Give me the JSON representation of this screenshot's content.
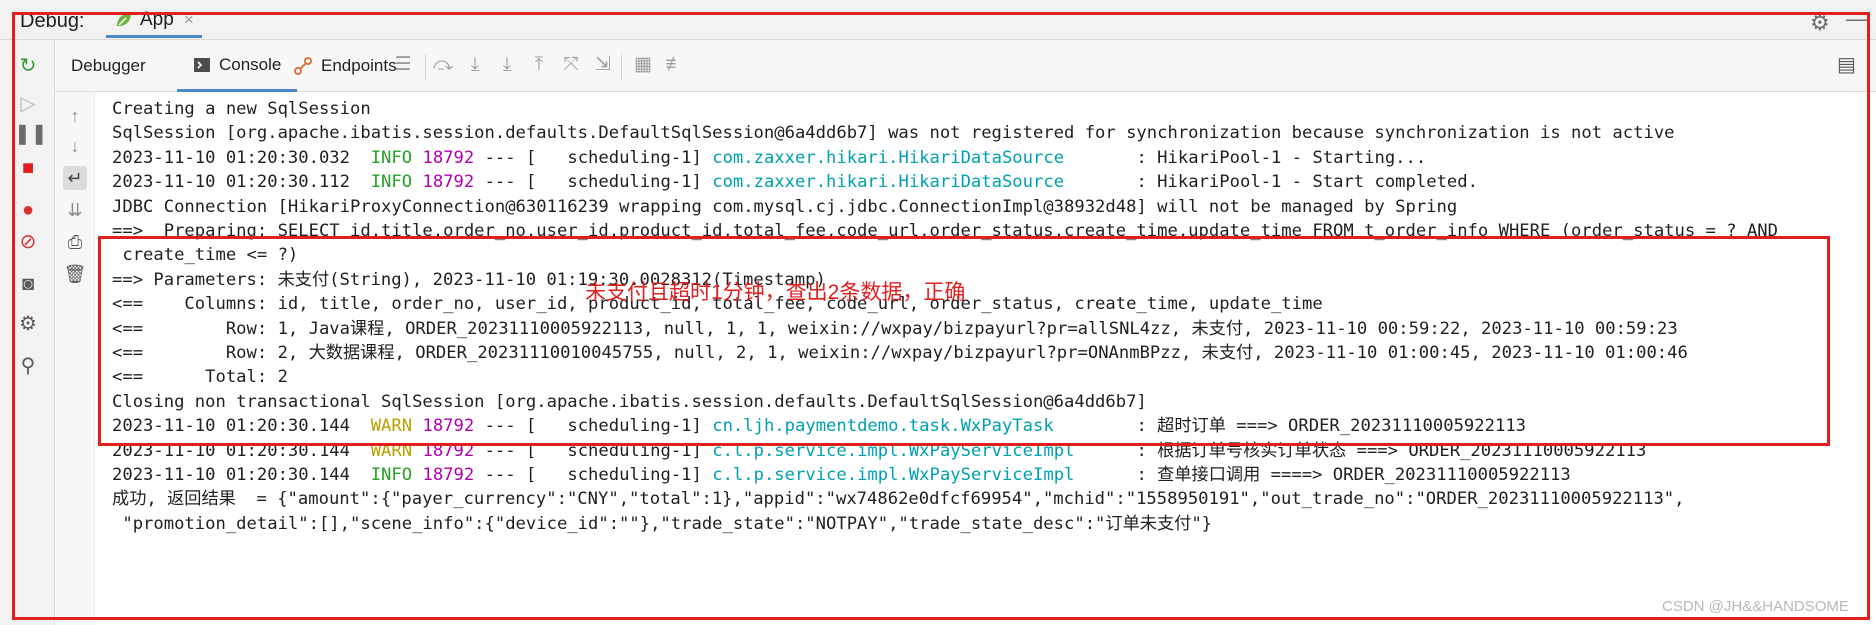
{
  "header": {
    "debug_label": "Debug:",
    "app_tab": "App",
    "close_glyph": "×",
    "gear_glyph": "⚙",
    "minimize_glyph": "—"
  },
  "subtabs": {
    "debugger": "Debugger",
    "console": "Console",
    "endpoints": "Endpoints"
  },
  "console": {
    "lines": [
      [
        {
          "t": "Creating a new SqlSession"
        }
      ],
      [
        {
          "t": "SqlSession [org.apache.ibatis.session.defaults.DefaultSqlSession@6a4dd6b7] was not registered for synchronization because synchronization is not active"
        }
      ],
      [
        {
          "t": "2023-11-10 01:20:30.032  "
        },
        {
          "t": "INFO",
          "c": "info"
        },
        {
          "t": " "
        },
        {
          "t": "18792",
          "c": "pid"
        },
        {
          "t": " --- [   scheduling-1] "
        },
        {
          "t": "com.zaxxer.hikari.HikariDataSource      ",
          "c": "cyan"
        },
        {
          "t": " : HikariPool-1 - Starting..."
        }
      ],
      [
        {
          "t": "2023-11-10 01:20:30.112  "
        },
        {
          "t": "INFO",
          "c": "info"
        },
        {
          "t": " "
        },
        {
          "t": "18792",
          "c": "pid"
        },
        {
          "t": " --- [   scheduling-1] "
        },
        {
          "t": "com.zaxxer.hikari.HikariDataSource      ",
          "c": "cyan"
        },
        {
          "t": " : HikariPool-1 - Start completed."
        }
      ],
      [
        {
          "t": "JDBC Connection [HikariProxyConnection@630116239 wrapping com.mysql.cj.jdbc.ConnectionImpl@38932d48] will not be managed by Spring"
        }
      ],
      [
        {
          "t": "==>  Preparing: SELECT id,title,order_no,user_id,product_id,total_fee,code_url,order_status,create_time,update_time FROM t_order_info WHERE (order_status = ? AND"
        }
      ],
      [
        {
          "t": " create_time <= ?)"
        }
      ],
      [
        {
          "t": "==> Parameters: 未支付(String), 2023-11-10 01:19:30.0028312(Timestamp)"
        }
      ],
      [
        {
          "t": "<==    Columns: id, title, order_no, user_id, product_id, total_fee, code_url, order_status, create_time, update_time"
        }
      ],
      [
        {
          "t": "<==        Row: 1, Java课程, ORDER_20231110005922113, null, 1, 1, weixin://wxpay/bizpayurl?pr=allSNL4zz, 未支付, 2023-11-10 00:59:22, 2023-11-10 00:59:23"
        }
      ],
      [
        {
          "t": "<==        Row: 2, 大数据课程, ORDER_20231110010045755, null, 2, 1, weixin://wxpay/bizpayurl?pr=ONAnmBPzz, 未支付, 2023-11-10 01:00:45, 2023-11-10 01:00:46"
        }
      ],
      [
        {
          "t": "<==      Total: 2"
        }
      ],
      [
        {
          "t": "Closing non transactional SqlSession [org.apache.ibatis.session.defaults.DefaultSqlSession@6a4dd6b7]"
        }
      ],
      [
        {
          "t": "2023-11-10 01:20:30.144  "
        },
        {
          "t": "WARN",
          "c": "warn"
        },
        {
          "t": " "
        },
        {
          "t": "18792",
          "c": "pid"
        },
        {
          "t": " --- [   scheduling-1] "
        },
        {
          "t": "cn.ljh.paymentdemo.task.WxPayTask       ",
          "c": "cyan"
        },
        {
          "t": " : 超时订单 ===> ORDER_20231110005922113"
        }
      ],
      [
        {
          "t": "2023-11-10 01:20:30.144  "
        },
        {
          "t": "WARN",
          "c": "warn"
        },
        {
          "t": " "
        },
        {
          "t": "18792",
          "c": "pid"
        },
        {
          "t": " --- [   scheduling-1] "
        },
        {
          "t": "c.l.p.service.impl.WxPayServiceImpl     ",
          "c": "cyan"
        },
        {
          "t": " : 根据订单号核实订单状态 ===> ORDER_20231110005922113"
        }
      ],
      [
        {
          "t": "2023-11-10 01:20:30.144  "
        },
        {
          "t": "INFO",
          "c": "info"
        },
        {
          "t": " "
        },
        {
          "t": "18792",
          "c": "pid"
        },
        {
          "t": " --- [   scheduling-1] "
        },
        {
          "t": "c.l.p.service.impl.WxPayServiceImpl     ",
          "c": "cyan"
        },
        {
          "t": " : 查单接口调用 ====> ORDER_20231110005922113"
        }
      ],
      [
        {
          "t": "成功, 返回结果  = {\"amount\":{\"payer_currency\":\"CNY\",\"total\":1},\"appid\":\"wx74862e0dfcf69954\",\"mchid\":\"1558950191\",\"out_trade_no\":\"ORDER_20231110005922113\","
        }
      ],
      [
        {
          "t": " \"promotion_detail\":[],\"scene_info\":{\"device_id\":\"\"},\"trade_state\":\"NOTPAY\",\"trade_state_desc\":\"订单未支付\"}"
        }
      ]
    ]
  },
  "annotation": "未支付且超时1分钟，查出2条数据，正确",
  "watermark": "CSDN @JH&&HANDSOME",
  "colors": {
    "accent_tab": "#4a86c8",
    "annotation_red": "#e0201f",
    "logger_cyan": "#00a0b0",
    "info_green": "#26a026",
    "warn_yellow": "#b8a000",
    "pid_magenta": "#b000b0"
  },
  "icons": {
    "left_toolbar": [
      "rerun-icon",
      "resume-icon",
      "pause-icon",
      "stop-icon",
      "view-breakpoints-icon",
      "mute-breakpoints-icon",
      "camera-icon",
      "settings-icon",
      "pin-icon"
    ],
    "gutter": [
      "scroll-up-icon",
      "scroll-down-icon",
      "soft-wrap-icon",
      "scroll-to-end-icon",
      "print-icon",
      "clear-all-icon"
    ],
    "toolbar": [
      "frames-icon",
      "step-over-icon",
      "step-into-icon",
      "force-step-into-icon",
      "step-out-icon",
      "drop-frame-icon",
      "run-to-cursor-icon",
      "evaluate-icon",
      "trace-icon"
    ]
  }
}
